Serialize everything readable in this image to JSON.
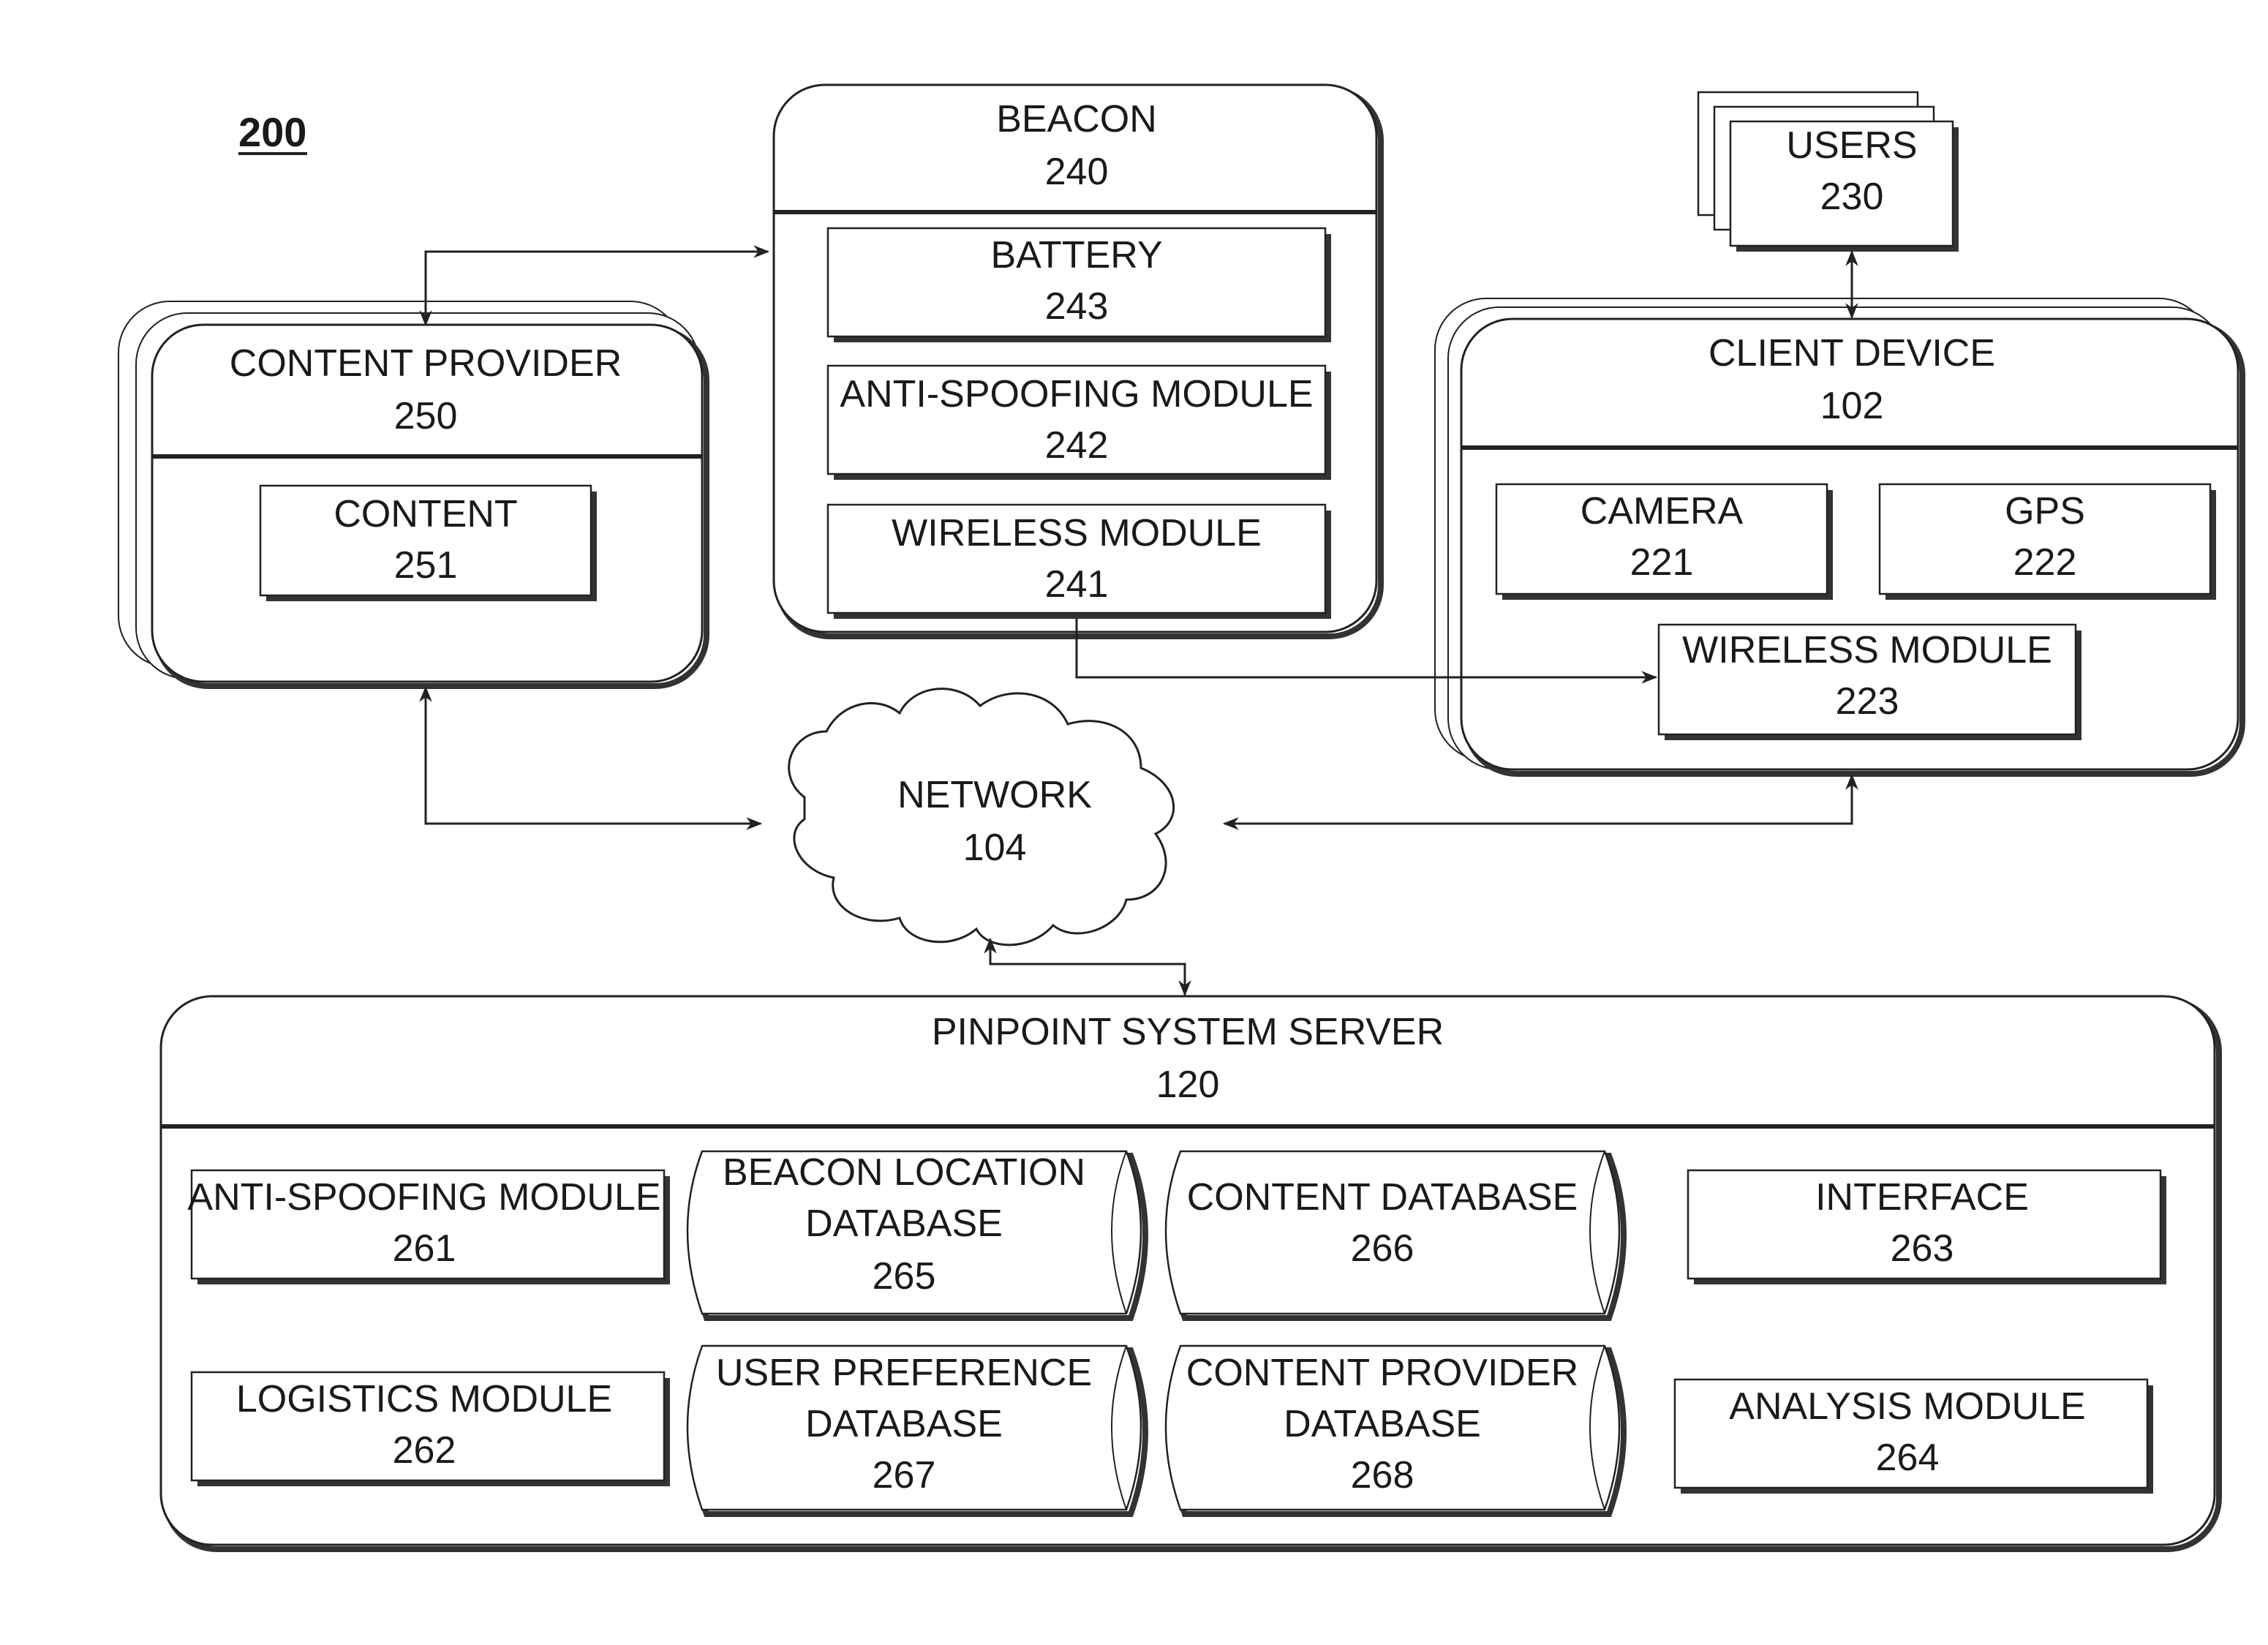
{
  "figure_label": "200",
  "content_provider": {
    "title": "CONTENT PROVIDER",
    "number": "250",
    "children": [
      {
        "title": "CONTENT",
        "number": "251"
      }
    ]
  },
  "beacon": {
    "title": "BEACON",
    "number": "240",
    "children": [
      {
        "title": "BATTERY",
        "number": "243"
      },
      {
        "title": "ANTI-SPOOFING MODULE",
        "number": "242"
      },
      {
        "title": "WIRELESS MODULE",
        "number": "241"
      }
    ]
  },
  "users": {
    "title": "USERS",
    "number": "230"
  },
  "client_device": {
    "title": "CLIENT DEVICE",
    "number": "102",
    "children": [
      {
        "title": "CAMERA",
        "number": "221"
      },
      {
        "title": "GPS",
        "number": "222"
      },
      {
        "title": "WIRELESS MODULE",
        "number": "223"
      }
    ]
  },
  "network": {
    "title": "NETWORK",
    "number": "104"
  },
  "server": {
    "title": "PINPOINT SYSTEM SERVER",
    "number": "120",
    "modules": [
      {
        "title": "ANTI-SPOOFING MODULE",
        "number": "261"
      },
      {
        "title": "LOGISTICS MODULE",
        "number": "262"
      },
      {
        "title": "INTERFACE",
        "number": "263"
      },
      {
        "title": "ANALYSIS MODULE",
        "number": "264"
      }
    ],
    "databases": [
      {
        "line1": "BEACON LOCATION",
        "line2": "DATABASE",
        "number": "265"
      },
      {
        "line1": "CONTENT DATABASE",
        "line2": "",
        "number": "266"
      },
      {
        "line1": "USER PREFERENCE",
        "line2": "DATABASE",
        "number": "267"
      },
      {
        "line1": "CONTENT PROVIDER",
        "line2": "DATABASE",
        "number": "268"
      }
    ]
  }
}
